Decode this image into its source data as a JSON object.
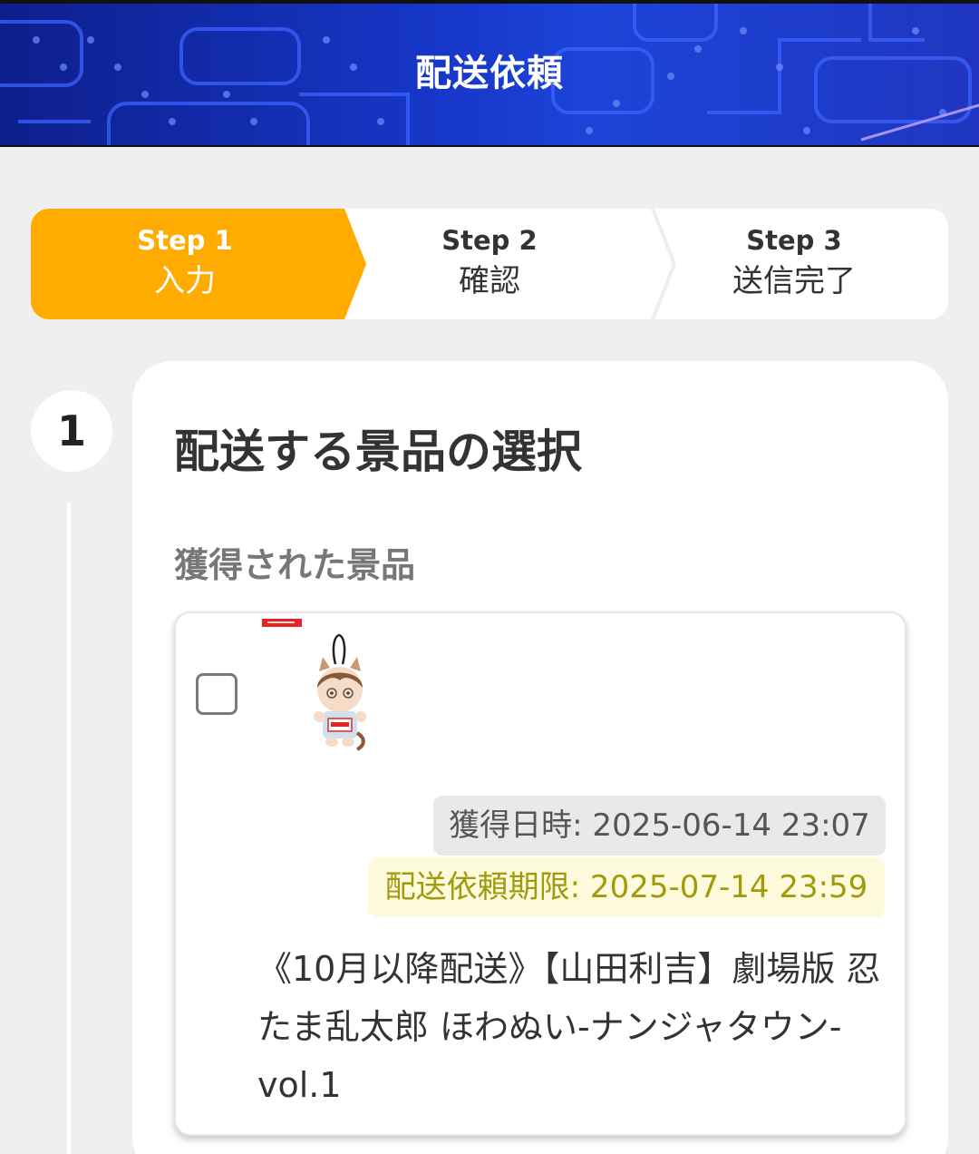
{
  "header": {
    "title": "配送依頼"
  },
  "stepper": {
    "steps": [
      {
        "number": "Step 1",
        "label": "入力",
        "active": true
      },
      {
        "number": "Step 2",
        "label": "確認",
        "active": false
      },
      {
        "number": "Step 3",
        "label": "送信完了",
        "active": false
      }
    ],
    "active_color": "#ffab00"
  },
  "section": {
    "badge": "1",
    "title": "配送する景品の選択",
    "subtitle": "獲得された景品"
  },
  "prize": {
    "checked": false,
    "image_icon": "plush-keychain-thumbnail",
    "acquired": "獲得日時: 2025-06-14 23:07",
    "deadline": "配送依頼期限: 2025-07-14 23:59",
    "name": "《10月以降配送》【山田利吉】劇場版 忍たま乱太郎 ほわぬい-ナンジャタウン-vol.1"
  },
  "colors": {
    "header_bg": "#1737c8",
    "deadline_text": "#a2990c",
    "deadline_bg": "#fdfbdc"
  }
}
